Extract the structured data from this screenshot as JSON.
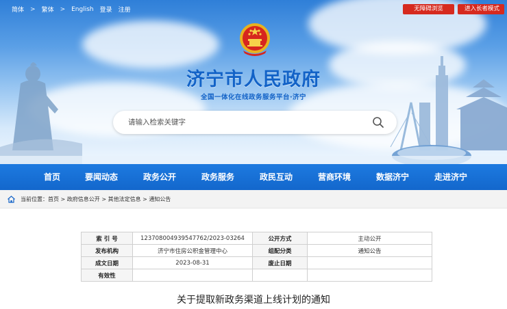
{
  "top_links": {
    "simplified": "简体",
    "traditional": "繁体",
    "english": "English",
    "login": "登录",
    "register": "注册",
    "sep": ">"
  },
  "top_buttons": {
    "accessible": "无障碍浏览",
    "elderly": "进入长者模式"
  },
  "site": {
    "title": "济宁市人民政府",
    "subtitle": "全国一体化在线政务服务平台·济宁"
  },
  "search": {
    "placeholder": "请输入检索关键字"
  },
  "nav": [
    "首页",
    "要闻动态",
    "政务公开",
    "政务服务",
    "政民互动",
    "营商环境",
    "数据济宁",
    "走进济宁"
  ],
  "breadcrumb": {
    "label": "当前位置：",
    "items": [
      "首页",
      "政府信息公开",
      "其他法定信息",
      "通知公告"
    ],
    "sep": " > "
  },
  "info_table": {
    "rows": [
      [
        "索 引 号",
        "123708004939547762/2023-03264",
        "公开方式",
        "主动公开"
      ],
      [
        "发布机构",
        "济宁市住房公积金管理中心",
        "组配分类",
        "通知公告"
      ],
      [
        "成文日期",
        "2023-08-31",
        "废止日期",
        ""
      ],
      [
        "有效性",
        "",
        "",
        ""
      ]
    ]
  },
  "document": {
    "title": "关于提取新政务渠道上线计划的通知"
  },
  "colors": {
    "brand_blue": "#1262c7",
    "nav_blue": "#1367cc",
    "top_button_red": "#d62a1f"
  }
}
